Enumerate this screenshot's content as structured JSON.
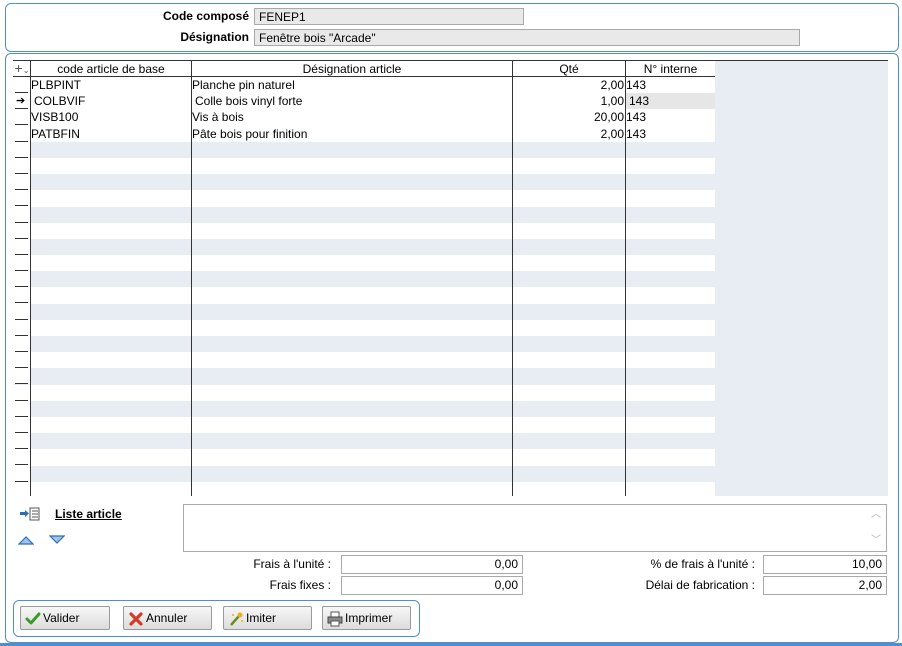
{
  "header": {
    "code_label": "Code composé",
    "code_value": "FENEP1",
    "designation_label": "Désignation",
    "designation_value": "Fenêtre bois \"Arcade\""
  },
  "grid": {
    "columns": [
      "code article de base",
      "Désignation article",
      "Qté",
      "N° interne"
    ],
    "rows": [
      {
        "code": "PLBPINT",
        "designation": "Planche pin naturel",
        "qte": "2,00",
        "interne": "143"
      },
      {
        "code": "COLBVIF",
        "designation": "Colle bois vinyl forte",
        "qte": "1,00",
        "interne": "143"
      },
      {
        "code": "VISB100",
        "designation": "Vis à  bois",
        "qte": "20,00",
        "interne": "143"
      },
      {
        "code": "PATBFIN",
        "designation": "Pâte bois pour finition",
        "qte": "2,00",
        "interne": "143"
      }
    ],
    "selected_row_index": 1
  },
  "liste": {
    "title": "Liste article"
  },
  "costs": {
    "frais_unite_label": "Frais à l'unité :",
    "frais_unite_value": "0,00",
    "frais_fixes_label": "Frais fixes :",
    "frais_fixes_value": "0,00",
    "pct_frais_label": "% de frais à l'unité :",
    "pct_frais_value": "10,00",
    "delai_label": "Délai de fabrication :",
    "delai_value": "2,00"
  },
  "buttons": {
    "valider": "Valider",
    "annuler": "Annuler",
    "imiter": "Imiter",
    "imprimer": "Imprimer"
  },
  "icons": {
    "valider": "check-icon",
    "annuler": "cross-icon",
    "imiter": "wand-icon",
    "imprimer": "printer-icon"
  },
  "colors": {
    "panel_border": "#4f8fcf",
    "grid_alt": "#e8ecf3"
  }
}
